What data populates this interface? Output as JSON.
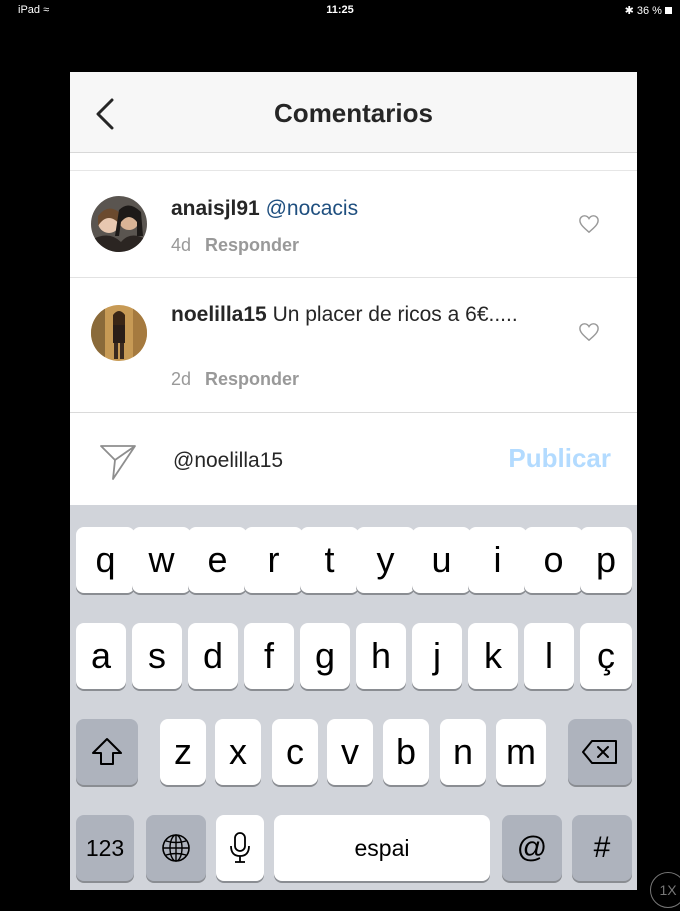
{
  "status_bar": {
    "device": "iPad",
    "time": "11:25",
    "battery": "36 %"
  },
  "header": {
    "title": "Comentarios"
  },
  "comments": [
    {
      "username": "anaisjl91",
      "text": "@nocacis",
      "age": "4d",
      "reply_label": "Responder"
    },
    {
      "username": "noelilla15",
      "text": "Un placer de ricos a 6€.....",
      "age": "2d",
      "reply_label": "Responder"
    }
  ],
  "composer": {
    "value": "@noelilla15",
    "publish_label": "Publicar"
  },
  "keyboard": {
    "row1": [
      "q",
      "w",
      "e",
      "r",
      "t",
      "y",
      "u",
      "i",
      "o",
      "p"
    ],
    "row2": [
      "a",
      "s",
      "d",
      "f",
      "g",
      "h",
      "j",
      "k",
      "l",
      "ç"
    ],
    "row3": [
      "z",
      "x",
      "c",
      "v",
      "b",
      "n",
      "m"
    ],
    "numbers_label": "123",
    "space_label": "espai",
    "at_label": "@",
    "hash_label": "#"
  },
  "zoom_label": "1X",
  "colors": {
    "accent_disabled": "#b3dbff",
    "mention": "#1f4f7f",
    "keyboard_bg": "#d1d4da"
  }
}
